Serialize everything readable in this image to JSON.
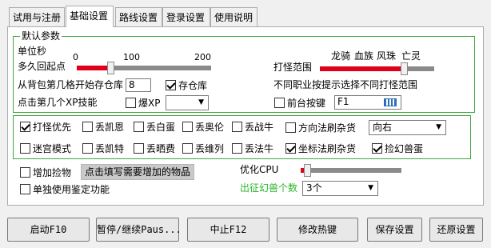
{
  "tabs": [
    "试用与注册",
    "基础设置",
    "路线设置",
    "登录设置",
    "使用说明"
  ],
  "default_params": {
    "title": "默认参数",
    "unit_label": "单位秒",
    "return_label": "多久回起点",
    "scale_0": "0",
    "scale_100": "100",
    "scale_200": "200",
    "return_value": 25,
    "attack_range_label": "打怪范围",
    "attack_range_value": 72,
    "range_names": [
      "龙骑",
      "血族",
      "风珠",
      "亡灵"
    ],
    "bag_label": "从背包第几格开始存仓库",
    "bag_value": "8",
    "store_label": "存仓库",
    "store_checked": true,
    "job_hint": "不同职业按提示选择不同打怪范围",
    "xp_label": "点击第几个XP技能",
    "burst_xp_label": "爆XP",
    "burst_xp_checked": false,
    "xp_select_value": "",
    "front_key_label": "前台按键",
    "front_key_checked": false,
    "front_key_value": "F1"
  },
  "options": {
    "row1": [
      {
        "label": "打怪优先",
        "checked": true
      },
      {
        "label": "丢凯恩",
        "checked": false
      },
      {
        "label": "丢白蛋",
        "checked": false
      },
      {
        "label": "丢奥伦",
        "checked": false
      },
      {
        "label": "丢战牛",
        "checked": false
      },
      {
        "label": "方向法刷杂货",
        "checked": false
      }
    ],
    "row2": [
      {
        "label": "迷宫模式",
        "checked": false
      },
      {
        "label": "丢凯特",
        "checked": false
      },
      {
        "label": "丢晒费",
        "checked": false
      },
      {
        "label": "丢维列",
        "checked": false
      },
      {
        "label": "丢法牛",
        "checked": false
      },
      {
        "label": "坐标法刷杂货",
        "checked": true
      },
      {
        "label": "捡幻兽蛋",
        "checked": true
      }
    ],
    "direction_value": "向右"
  },
  "extra": {
    "add_pickup_label": "增加捡物",
    "add_pickup_checked": false,
    "fill_items_button": "点击填写需要增加的物品",
    "identify_label": "单独使用鉴定功能",
    "identify_checked": false,
    "cpu_label": "优化CPU",
    "cpu_value": 5,
    "pet_count_label": "出征幻兽个数",
    "pet_count_value": "3个"
  },
  "buttons": {
    "start": "启动F10",
    "pause": "暂停/继续Paus...",
    "stop": "中止F12",
    "hotkey": "修改热键",
    "save": "保存设置",
    "restore": "还原设置"
  },
  "colors": {
    "group_border": "#3fa63f",
    "red_fill": "#e0001a",
    "pet_label_color": "#2db52d"
  }
}
